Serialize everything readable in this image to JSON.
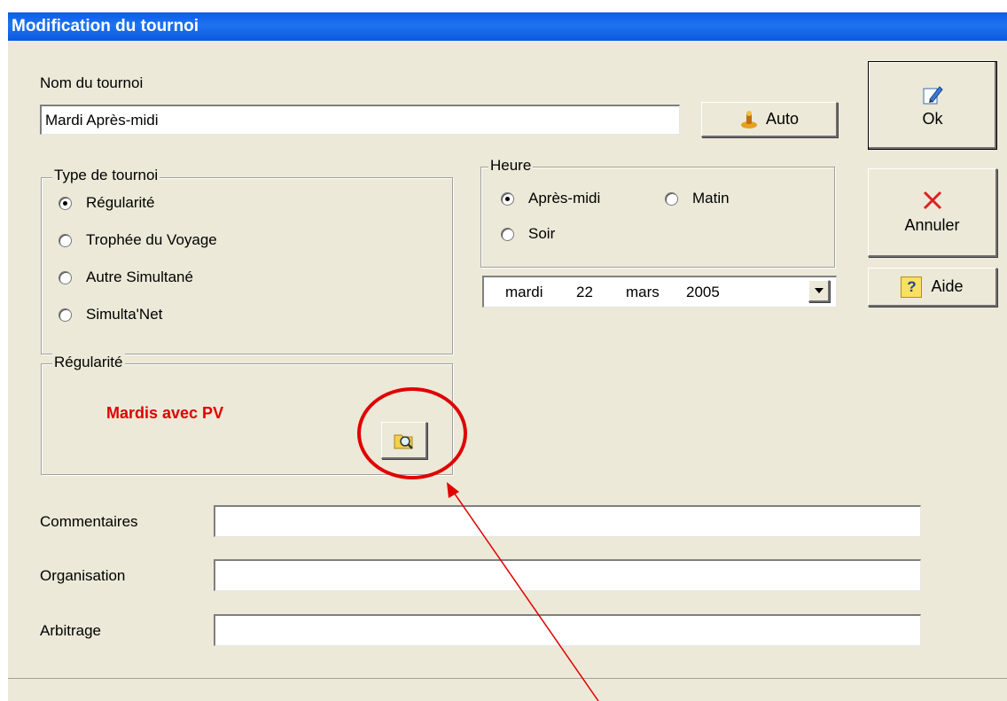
{
  "window": {
    "title": "Modification du tournoi"
  },
  "name_section": {
    "label": "Nom du tournoi",
    "value": "Mardi Après-midi",
    "auto_button": "Auto"
  },
  "buttons": {
    "ok": "Ok",
    "cancel": "Annuler",
    "help": "Aide"
  },
  "tournament_type": {
    "title": "Type de tournoi",
    "options": [
      {
        "label": "Régularité",
        "checked": true
      },
      {
        "label": "Trophée du Voyage",
        "checked": false
      },
      {
        "label": "Autre Simultané",
        "checked": false
      },
      {
        "label": "Simulta'Net",
        "checked": false
      }
    ]
  },
  "time_of_day": {
    "title": "Heure",
    "options": [
      {
        "label": "Après-midi",
        "checked": true
      },
      {
        "label": "Matin",
        "checked": false
      },
      {
        "label": "Soir",
        "checked": false
      }
    ]
  },
  "date": {
    "weekday": "mardi",
    "day": "22",
    "month": "mars",
    "year": "2005"
  },
  "regularity": {
    "title": "Régularité",
    "value": "Mardis avec PV",
    "value_color": "#e00000"
  },
  "fields": {
    "comments_label": "Commentaires",
    "comments_value": "",
    "organisation_label": "Organisation",
    "organisation_value": "",
    "arbitrage_label": "Arbitrage",
    "arbitrage_value": ""
  },
  "colors": {
    "titlebar": "#0a5ce8",
    "highlight_circle": "#e00000",
    "window_bg": "#ece9d8"
  }
}
